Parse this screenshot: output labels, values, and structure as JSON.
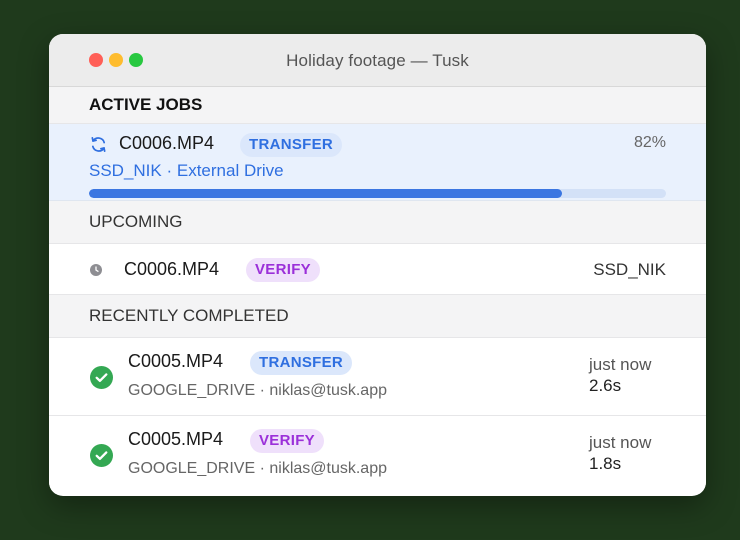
{
  "window": {
    "title": "Holiday footage — Tusk"
  },
  "colors": {
    "accent": "#3b76e1",
    "transfer_badge": "#2f6fe0",
    "verify_badge": "#9b30d9",
    "success": "#34a853",
    "background": "#1f3a1c"
  },
  "active": {
    "header": "ACTIVE JOBS",
    "job": {
      "icon": "sync-icon",
      "file": "C0006.MP4",
      "badge": "TRANSFER",
      "percent": "82%",
      "progress": 0.82,
      "subtitle": "SSD_NIK · External Drive"
    }
  },
  "upcoming": {
    "header": "UPCOMING",
    "job": {
      "icon": "clock-icon",
      "file": "C0006.MP4",
      "badge": "VERIFY",
      "destination": "SSD_NIK"
    }
  },
  "completed": {
    "header": "RECENTLY COMPLETED",
    "items": [
      {
        "icon": "check-circle-icon",
        "file": "C0005.MP4",
        "badge": "TRANSFER",
        "subtitle": "GOOGLE_DRIVE · niklas@tusk.app",
        "time": "just now",
        "duration": "2.6s"
      },
      {
        "icon": "check-circle-icon",
        "file": "C0005.MP4",
        "badge": "VERIFY",
        "subtitle": "GOOGLE_DRIVE · niklas@tusk.app",
        "time": "just now",
        "duration": "1.8s"
      }
    ]
  }
}
